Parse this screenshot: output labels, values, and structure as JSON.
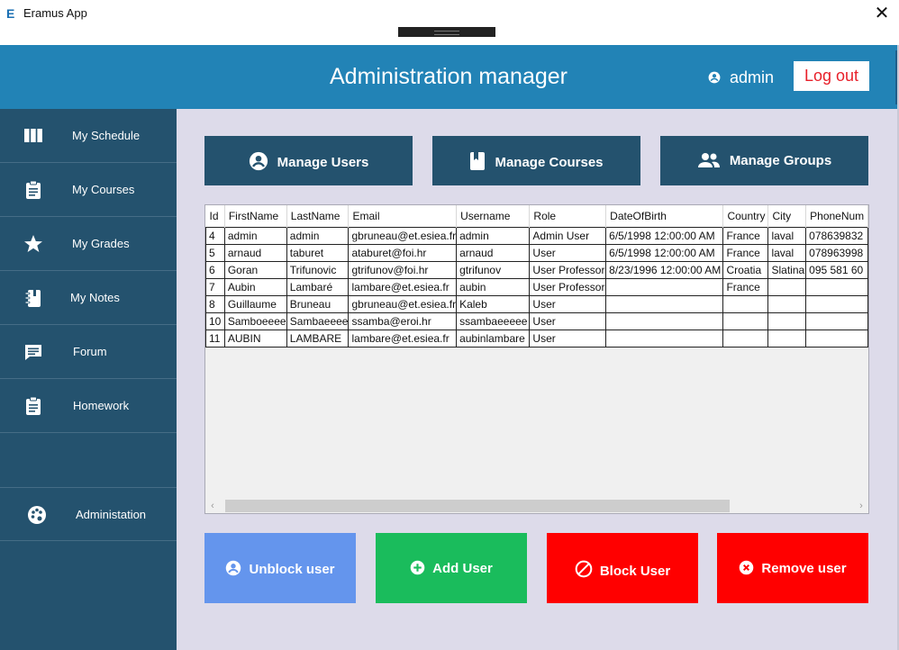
{
  "window": {
    "title": "Eramus App",
    "icon_letter": "E",
    "close_glyph": "✕"
  },
  "header": {
    "title": "Administration manager",
    "username": "admin",
    "logout_label": "Log out"
  },
  "sidebar": {
    "items": [
      {
        "label": "My Schedule",
        "icon": "schedule-icon"
      },
      {
        "label": "My Courses",
        "icon": "clipboard-icon"
      },
      {
        "label": "My Grades",
        "icon": "star-icon"
      },
      {
        "label": "My Notes",
        "icon": "notebook-icon"
      },
      {
        "label": "Forum",
        "icon": "chat-icon"
      },
      {
        "label": "Homework",
        "icon": "clipboard-icon"
      }
    ],
    "admin_item": {
      "label": "Administation",
      "icon": "palette-icon"
    }
  },
  "actions": {
    "manage_users": "Manage Users",
    "manage_courses": "Manage Courses",
    "manage_groups": "Manage Groups",
    "unblock_user": "Unblock user",
    "add_user": "Add User",
    "block_user": "Block User",
    "remove_user": "Remove user"
  },
  "colors": {
    "header": "#2283b6",
    "sidebar": "#24526e",
    "unblock": "#6495ed",
    "add": "#1abc5c",
    "block": "#ff0000",
    "remove": "#ff0000"
  },
  "table": {
    "columns": [
      "Id",
      "FirstName",
      "LastName",
      "Email",
      "Username",
      "Role",
      "DateOfBirth",
      "Country",
      "City",
      "PhoneNum"
    ],
    "rows": [
      [
        "4",
        "admin",
        "admin",
        "gbruneau@et.esiea.fr",
        "admin",
        "Admin User",
        "6/5/1998 12:00:00 AM",
        "France",
        "laval",
        "078639832"
      ],
      [
        "5",
        "arnaud",
        "taburet",
        "ataburet@foi.hr",
        "arnaud",
        "User",
        "6/5/1998 12:00:00 AM",
        "France",
        "laval",
        "078963998"
      ],
      [
        "6",
        "Goran",
        "Trifunovic",
        "gtrifunov@foi.hr",
        "gtrifunov",
        "User Professor",
        "8/23/1996 12:00:00 AM",
        "Croatia",
        "Slatina",
        "095 581 60"
      ],
      [
        "7",
        "Aubin",
        "Lambaré",
        "lambare@et.esiea.fr",
        "aubin",
        "User Professor",
        "",
        "France",
        "",
        ""
      ],
      [
        "8",
        "Guillaume",
        "Bruneau",
        "gbruneau@et.esiea.fr",
        "Kaleb",
        "User",
        "",
        "",
        "",
        ""
      ],
      [
        "10",
        "Samboeeee",
        "Sambaeeee",
        "ssamba@eroi.hr",
        "ssambaeeeee",
        "User",
        "",
        "",
        "",
        ""
      ],
      [
        "11",
        "AUBIN",
        "LAMBARE",
        "lambare@et.esiea.fr",
        "aubinlambare",
        "User",
        "",
        "",
        "",
        ""
      ]
    ]
  }
}
